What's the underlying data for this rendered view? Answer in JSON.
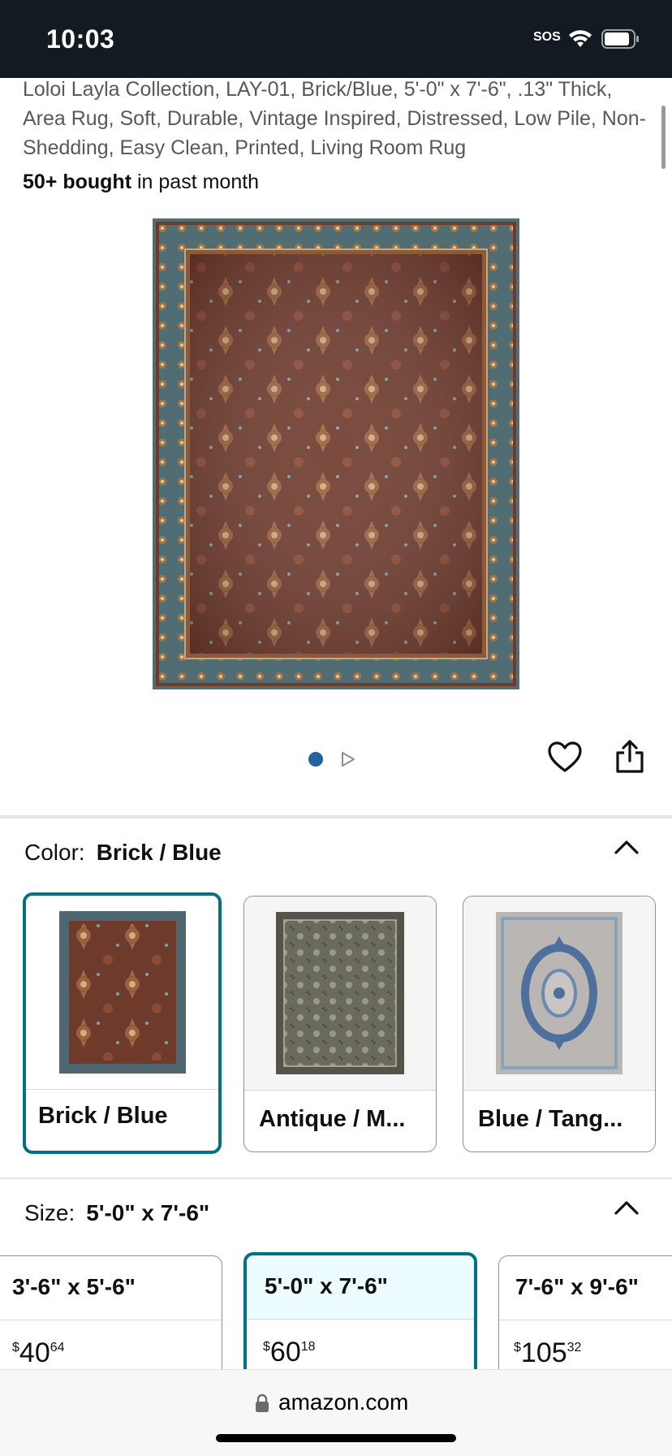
{
  "status_bar": {
    "time": "10:03",
    "sos": "SOS"
  },
  "product": {
    "title": "Loloi Layla Collection, LAY-01, Brick/Blue, 5'-0\" x 7'-6\", .13\" Thick, Area Rug, Soft, Durable, Vintage Inspired, Distressed, Low Pile, Non-Shedding, Easy Clean, Printed, Living Room Rug",
    "bought_bold": "50+ bought",
    "bought_rest": " in past month"
  },
  "carousel": {
    "active_index": 1,
    "total_indicators": 2
  },
  "color": {
    "label": "Color:",
    "selected": "Brick / Blue",
    "options": [
      {
        "label": "Brick / Blue",
        "selected": true,
        "palette": "brick"
      },
      {
        "label": "Antique / M...",
        "selected": false,
        "palette": "antique"
      },
      {
        "label": "Blue / Tang...",
        "selected": false,
        "palette": "blue"
      }
    ]
  },
  "size": {
    "label": "Size:",
    "selected": "5'-0\" x 7'-6\"",
    "options": [
      {
        "dim": "3'-6\" x 5'-6\"",
        "currency": "$",
        "whole": "40",
        "fraction": "64",
        "selected": false
      },
      {
        "dim": "5'-0\" x 7'-6\"",
        "currency": "$",
        "whole": "60",
        "fraction": "18",
        "selected": true
      },
      {
        "dim": "7'-6\" x 9'-6\"",
        "currency": "$",
        "whole": "105",
        "fraction": "32",
        "selected": false
      }
    ]
  },
  "browser": {
    "url": "amazon.com"
  },
  "colors": {
    "accent": "#007185",
    "dot": "#2162a1",
    "statusbar": "#131a22"
  }
}
